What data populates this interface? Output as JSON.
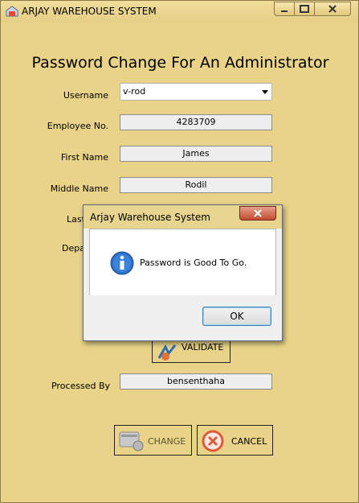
{
  "window": {
    "title": "ARJAY WAREHOUSE SYSTEM"
  },
  "form": {
    "heading": "Password Change For An Administrator",
    "username_label": "Username",
    "username_value": "v-rod",
    "employee_no_label": "Employee No.",
    "employee_no_value": "4283709",
    "first_name_label": "First Name",
    "first_name_value": "James",
    "middle_name_label": "Middle Name",
    "middle_name_value": "Rodil",
    "last_name_label_partial": "Last",
    "department_label_partial": "Depa",
    "validate_label": "VALIDATE",
    "processed_by_label": "Processed By",
    "processed_by_value": "bensenthaha",
    "change_label": "CHANGE",
    "cancel_label": "CANCEL"
  },
  "dialog": {
    "title": "Arjay Warehouse System",
    "message": "Password is Good To Go.",
    "ok_label": "OK"
  },
  "icons": {
    "app": "warehouse-icon",
    "info": "info-icon",
    "close": "close-icon",
    "validate": "validate-icon",
    "change": "change-icon",
    "cancel": "cancel-icon"
  }
}
